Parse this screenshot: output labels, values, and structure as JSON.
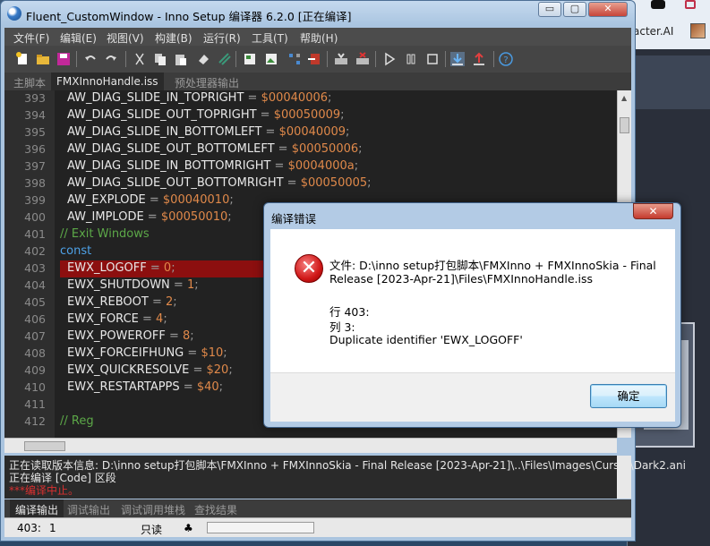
{
  "window": {
    "title": "Fluent_CustomWindow - Inno Setup 编译器 6.2.0  [正在编译]",
    "minimize_glyph": "▭",
    "maximize_glyph": "▢",
    "close_glyph": "✕"
  },
  "background_window": {
    "text": "acter.AI"
  },
  "menu": [
    "文件(F)",
    "编辑(E)",
    "视图(V)",
    "构建(B)",
    "运行(R)",
    "工具(T)",
    "帮助(H)"
  ],
  "toolbar": {
    "icons": [
      "new-file-icon",
      "open-folder-icon",
      "save-icon",
      "undo-icon",
      "redo-icon",
      "cut-icon",
      "copy-icon",
      "paste-icon",
      "erase-icon",
      "comment-icon",
      "wizard-icon",
      "image-icon",
      "tree-icon",
      "export-icon",
      "compile-icon",
      "stop-compile-icon",
      "run-icon",
      "pause-icon",
      "stop-icon",
      "download-icon",
      "upload-icon",
      "help-icon"
    ]
  },
  "tabs": {
    "main_script": "主脚本",
    "active": "FMXInnoHandle.iss",
    "preprocessor": "预处理器输出"
  },
  "editor": {
    "lines": [
      {
        "n": "393",
        "name": "AW_DIAG_SLIDE_IN_TOPRIGHT",
        "value": "$00040006"
      },
      {
        "n": "394",
        "name": "AW_DIAG_SLIDE_OUT_TOPRIGHT",
        "value": "$00050009"
      },
      {
        "n": "395",
        "name": "AW_DIAG_SLIDE_IN_BOTTOMLEFT",
        "value": "$00040009"
      },
      {
        "n": "396",
        "name": "AW_DIAG_SLIDE_OUT_BOTTOMLEFT",
        "value": "$00050006"
      },
      {
        "n": "397",
        "name": "AW_DIAG_SLIDE_IN_BOTTOMRIGHT",
        "value": "$0004000a"
      },
      {
        "n": "398",
        "name": "AW_DIAG_SLIDE_OUT_BOTTOMRIGHT",
        "value": "$00050005"
      },
      {
        "n": "399",
        "name": "AW_EXPLODE",
        "value": "$00040010"
      },
      {
        "n": "400",
        "name": "AW_IMPLODE",
        "value": "$00050010"
      },
      {
        "n": "401",
        "comment": "// Exit Windows"
      },
      {
        "n": "402",
        "keyword": "const"
      },
      {
        "n": "403",
        "name": "EWX_LOGOFF",
        "value": "0",
        "highlight": true
      },
      {
        "n": "404",
        "name": "EWX_SHUTDOWN",
        "value": "1"
      },
      {
        "n": "405",
        "name": "EWX_REBOOT",
        "value": "2"
      },
      {
        "n": "406",
        "name": "EWX_FORCE",
        "value": "4"
      },
      {
        "n": "407",
        "name": "EWX_POWEROFF",
        "value": "8"
      },
      {
        "n": "408",
        "name": "EWX_FORCEIFHUNG",
        "value": "$10"
      },
      {
        "n": "409",
        "name": "EWX_QUICKRESOLVE",
        "value": "$20"
      },
      {
        "n": "410",
        "name": "EWX_RESTARTAPPS",
        "value": "$40"
      },
      {
        "n": "411"
      },
      {
        "n": "412",
        "comment": "// Reg"
      }
    ],
    "equals": " = ",
    "semicolon": ";"
  },
  "output": {
    "line1": "正在读取版本信息: D:\\inno setup打包脚本\\FMXInno + FMXInnoSkia - Final Release [2023-Apr-21]\\..\\Files\\Images\\Cursor\\Dark2.ani",
    "line2": "正在编译 [Code] 区段",
    "line3": "***编译中止。"
  },
  "output_tabs": [
    "编译输出",
    "调试输出",
    "调试调用堆栈",
    "查找结果"
  ],
  "status": {
    "position": "403:",
    "column": "1",
    "mode": "只读"
  },
  "dialog": {
    "title": "编译错误",
    "close_glyph": "✕",
    "file_line1": "文件: D:\\inno setup打包脚本\\FMXInno + FMXInnoSkia - Final",
    "file_line2": "Release [2023-Apr-21]\\Files\\FMXInnoHandle.iss",
    "row": "行 403:",
    "col": "列 3:",
    "message": "Duplicate identifier 'EWX_LOGOFF'",
    "ok": "确定",
    "error_glyph": "✕"
  },
  "colors": {
    "editor_bg": "#222222",
    "number": "#e0894a",
    "comment": "#5ca848",
    "keyword": "#4ea2e8",
    "highlight": "#8c0f0f",
    "error_text": "#d83030"
  }
}
